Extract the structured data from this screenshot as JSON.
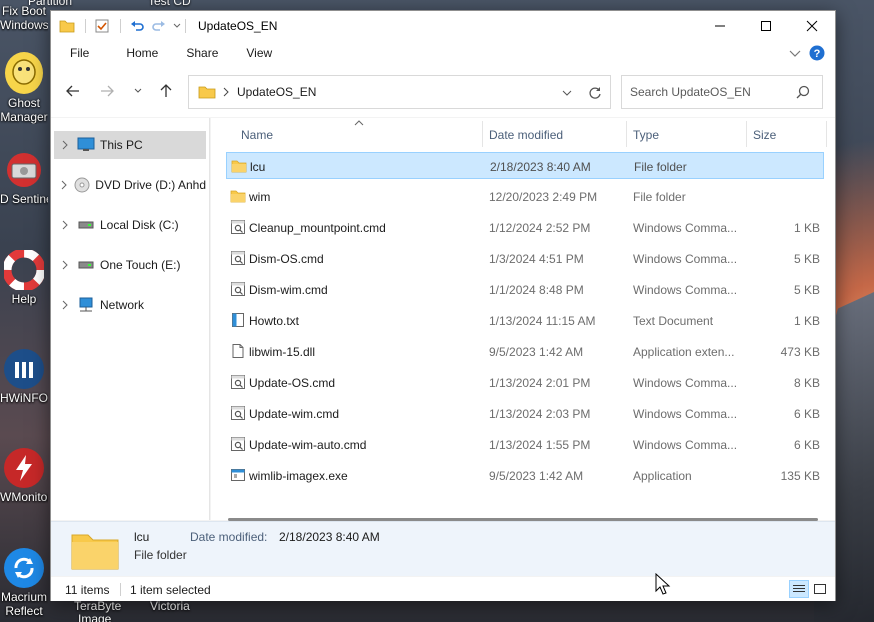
{
  "desktop": {
    "icons": [
      {
        "label": "Fix Boot Windows",
        "lines": [
          "Fix Boot",
          "Windows"
        ]
      },
      {
        "label": "Ghost Manager",
        "lines": [
          "Ghost",
          "Manager"
        ]
      },
      {
        "label": "HDD Sentinel",
        "lines": [
          "D Sentinel"
        ]
      },
      {
        "label": "Help",
        "lines": [
          "Help"
        ]
      },
      {
        "label": "HWiNFO",
        "lines": [
          "HWiNFO"
        ]
      },
      {
        "label": "HWMonitor",
        "lines": [
          "WMonitor"
        ]
      },
      {
        "label": "Macrium Reflect",
        "lines": [
          "Macrium",
          "Reflect"
        ]
      }
    ],
    "bottom_labels": [
      "TeraByte",
      "Image",
      "Victoria"
    ],
    "top_partial_labels": [
      "Partition",
      "Test CD"
    ]
  },
  "window": {
    "title": "UpdateOS_EN",
    "ribbon_tabs": [
      "File",
      "Home",
      "Share",
      "View"
    ],
    "address": {
      "path": "UpdateOS_EN"
    },
    "search": {
      "placeholder": "Search UpdateOS_EN"
    },
    "sidebar": [
      {
        "label": "This PC",
        "icon": "computer-icon",
        "selected": true
      },
      {
        "label": "DVD Drive (D:) Anhd",
        "icon": "dvd-drive-icon",
        "selected": false
      },
      {
        "label": "Local Disk (C:)",
        "icon": "disk-drive-icon",
        "selected": false
      },
      {
        "label": "One Touch (E:)",
        "icon": "disk-drive-icon",
        "selected": false
      },
      {
        "label": "Network",
        "icon": "network-icon",
        "selected": false
      }
    ],
    "columns": {
      "name": "Name",
      "date": "Date modified",
      "type": "Type",
      "size": "Size"
    },
    "files": [
      {
        "name": "lcu",
        "date": "2/18/2023 8:40 AM",
        "type": "File folder",
        "size": "",
        "icon": "folder-icon",
        "selected": true
      },
      {
        "name": "wim",
        "date": "12/20/2023 2:49 PM",
        "type": "File folder",
        "size": "",
        "icon": "folder-icon",
        "selected": false
      },
      {
        "name": "Cleanup_mountpoint.cmd",
        "date": "1/12/2024 2:52 PM",
        "type": "Windows Comma...",
        "size": "1 KB",
        "icon": "cmd-file-icon",
        "selected": false
      },
      {
        "name": "Dism-OS.cmd",
        "date": "1/3/2024 4:51 PM",
        "type": "Windows Comma...",
        "size": "5 KB",
        "icon": "cmd-file-icon",
        "selected": false
      },
      {
        "name": "Dism-wim.cmd",
        "date": "1/1/2024 8:48 PM",
        "type": "Windows Comma...",
        "size": "5 KB",
        "icon": "cmd-file-icon",
        "selected": false
      },
      {
        "name": "Howto.txt",
        "date": "1/13/2024 11:15 AM",
        "type": "Text Document",
        "size": "1 KB",
        "icon": "text-file-icon",
        "selected": false
      },
      {
        "name": "libwim-15.dll",
        "date": "9/5/2023 1:42 AM",
        "type": "Application exten...",
        "size": "473 KB",
        "icon": "dll-file-icon",
        "selected": false
      },
      {
        "name": "Update-OS.cmd",
        "date": "1/13/2024 2:01 PM",
        "type": "Windows Comma...",
        "size": "8 KB",
        "icon": "cmd-file-icon",
        "selected": false
      },
      {
        "name": "Update-wim.cmd",
        "date": "1/13/2024 2:03 PM",
        "type": "Windows Comma...",
        "size": "6 KB",
        "icon": "cmd-file-icon",
        "selected": false
      },
      {
        "name": "Update-wim-auto.cmd",
        "date": "1/13/2024 1:55 PM",
        "type": "Windows Comma...",
        "size": "6 KB",
        "icon": "cmd-file-icon",
        "selected": false
      },
      {
        "name": "wimlib-imagex.exe",
        "date": "9/5/2023 1:42 AM",
        "type": "Application",
        "size": "135 KB",
        "icon": "exe-file-icon",
        "selected": false
      }
    ],
    "details": {
      "name": "lcu",
      "type": "File folder",
      "date_label": "Date modified:",
      "date_value": "2/18/2023 8:40 AM"
    },
    "status": {
      "item_count": "11 items",
      "selection": "1 item selected"
    }
  },
  "colors": {
    "selection_bg": "#cce8ff",
    "selection_border": "#99d1ff",
    "folder": "#f8c94a",
    "help_blue": "#1f6fd1"
  }
}
